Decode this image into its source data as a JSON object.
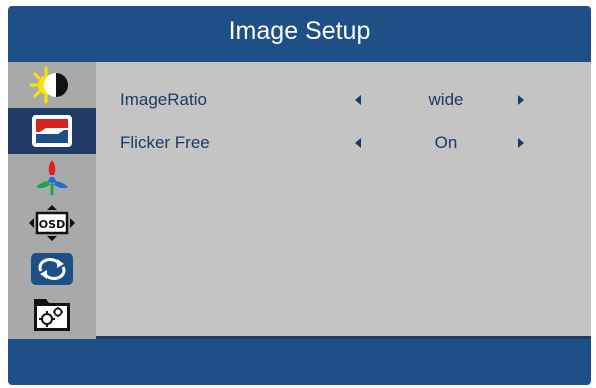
{
  "menu": {
    "title": "Image Setup",
    "selected_category": "image-setup",
    "categories": [
      {
        "name": "luminance",
        "icon": "brightness-contrast-icon"
      },
      {
        "name": "image-setup",
        "icon": "image-setup-icon"
      },
      {
        "name": "color-temp",
        "icon": "color-rgb-icon"
      },
      {
        "name": "osd-setup",
        "icon": "osd-icon"
      },
      {
        "name": "reset",
        "icon": "reset-arrows-icon"
      },
      {
        "name": "extra",
        "icon": "gears-folder-icon"
      }
    ],
    "settings": [
      {
        "label": "ImageRatio",
        "value": "wide"
      },
      {
        "label": "Flicker Free",
        "value": "On"
      }
    ]
  },
  "colors": {
    "frame": "#1e4f87",
    "sidebar": "#a9a9a9",
    "selected": "#1f3b66",
    "content": "#c4c4c4",
    "text": "#1d3a63"
  }
}
